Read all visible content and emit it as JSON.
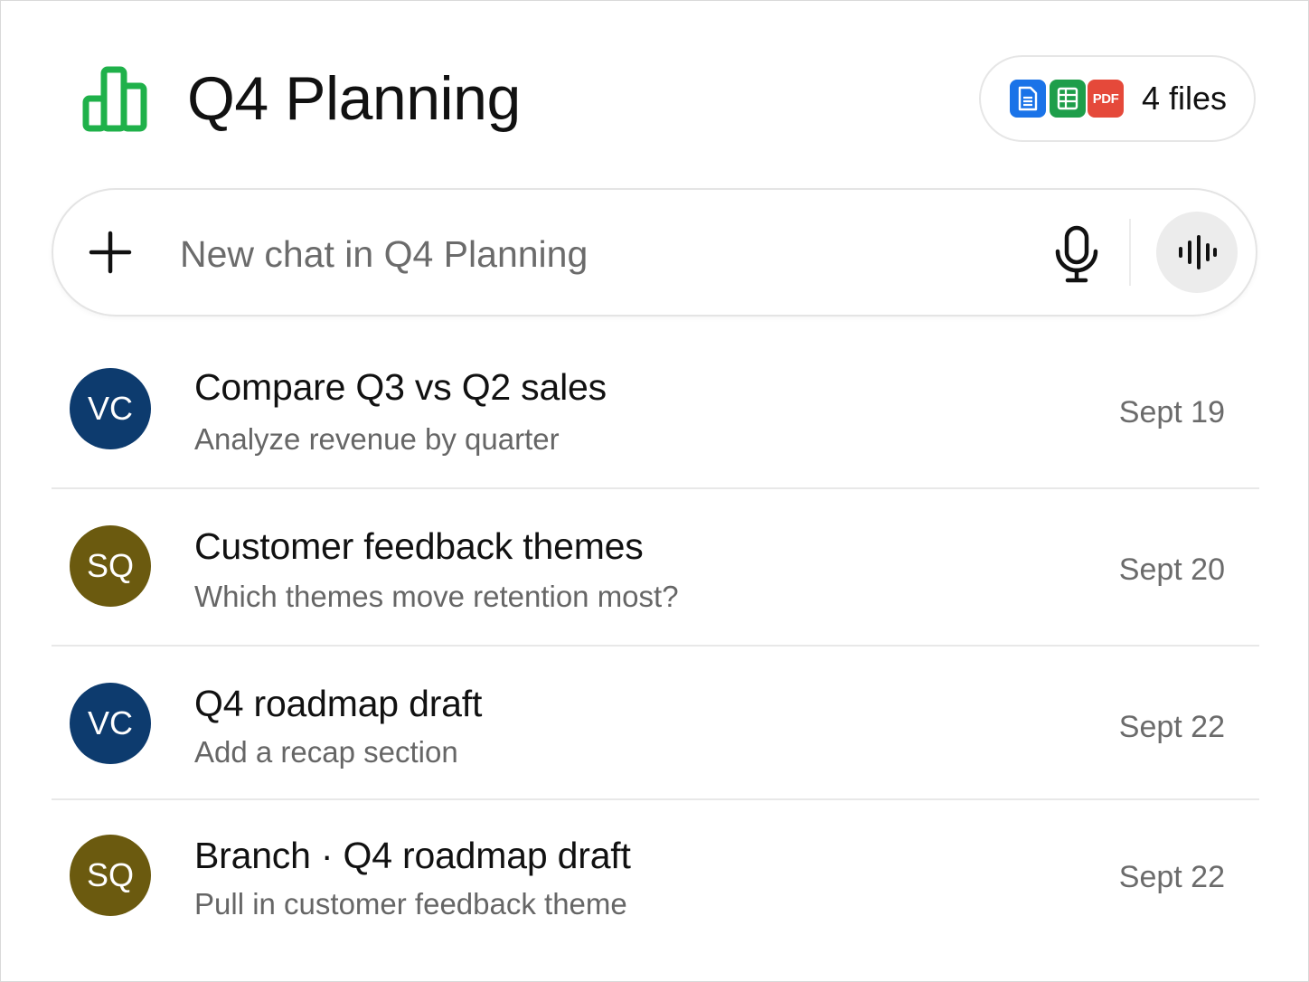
{
  "header": {
    "title": "Q4 Planning",
    "icon": "bar-chart-icon",
    "files": {
      "count_label": "4 files",
      "icons": [
        "document-icon",
        "spreadsheet-icon",
        "pdf-icon"
      ],
      "pdf_label": "PDF"
    }
  },
  "composer": {
    "placeholder": "New chat in Q4 Planning",
    "add_icon": "plus-icon",
    "mic_icon": "microphone-icon",
    "voice_icon": "voice-waveform-icon"
  },
  "chats": [
    {
      "avatar": "VC",
      "avatar_color": "#0d3b6e",
      "title": "Compare Q3 vs Q2 sales",
      "subtitle": "Analyze revenue by quarter",
      "date": "Sept 19"
    },
    {
      "avatar": "SQ",
      "avatar_color": "#6b5a0f",
      "title": "Customer feedback themes",
      "subtitle": "Which themes move retention most?",
      "date": "Sept 20"
    },
    {
      "avatar": "VC",
      "avatar_color": "#0d3b6e",
      "title": "Q4 roadmap draft",
      "subtitle": "Add a recap section",
      "date": "Sept 22"
    },
    {
      "avatar": "SQ",
      "avatar_color": "#6b5a0f",
      "title": "Branch · Q4 roadmap draft",
      "subtitle": "Pull in customer feedback theme",
      "date": "Sept 22"
    }
  ],
  "colors": {
    "accent_green": "#1fb14a",
    "doc_blue": "#1a73e8",
    "sheet_green": "#1e9e4a",
    "pdf_red": "#e5493a"
  }
}
